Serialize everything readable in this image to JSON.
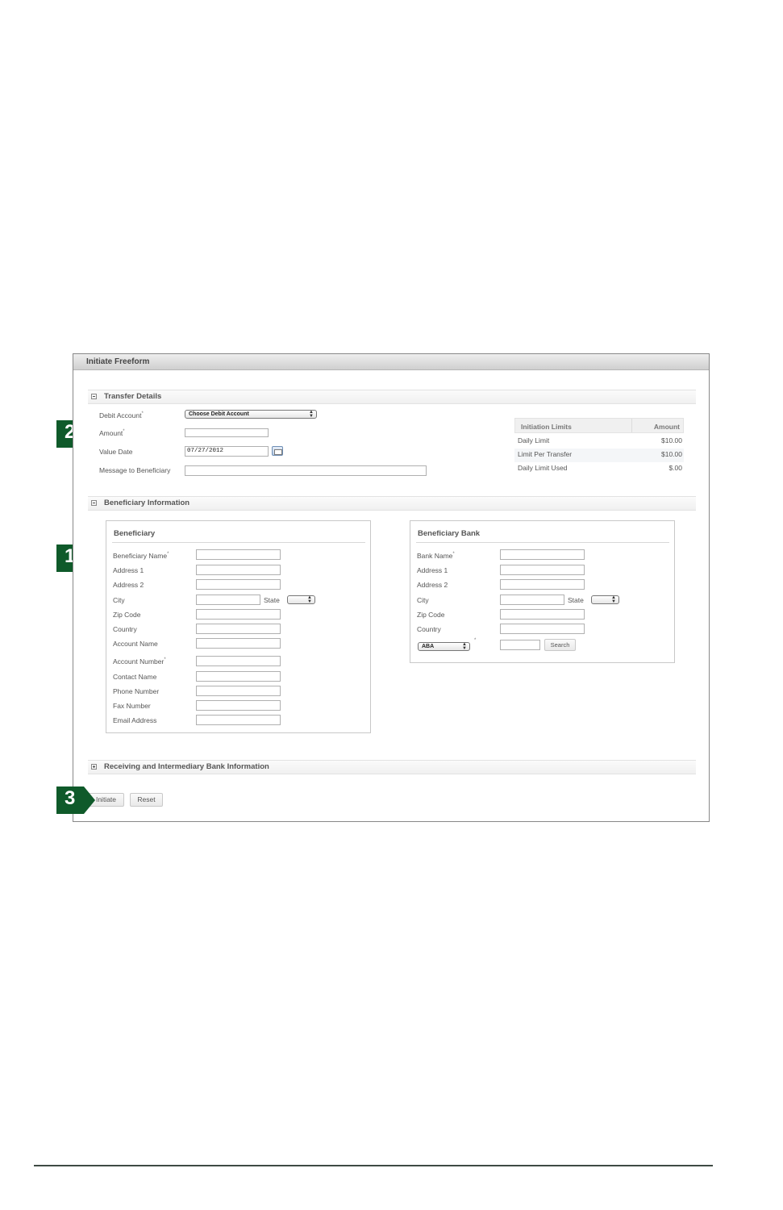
{
  "window": {
    "title": "Initiate Freeform"
  },
  "transfer_details": {
    "section_title": "Transfer Details",
    "debit_account_label": "Debit Account",
    "debit_account_value": "Choose Debit Account",
    "amount_label": "Amount",
    "value_date_label": "Value Date",
    "value_date_value": "07/27/2012",
    "message_label": "Message to Beneficiary",
    "required_marker": "*"
  },
  "initiation_limits": {
    "header_label": "Initiation Limits",
    "header_amount": "Amount",
    "rows": [
      {
        "label": "Daily Limit",
        "amount": "$10.00"
      },
      {
        "label": "Limit Per Transfer",
        "amount": "$10.00"
      },
      {
        "label": "Daily Limit Used",
        "amount": "$.00"
      }
    ]
  },
  "beneficiary_information": {
    "section_title": "Beneficiary Information",
    "beneficiary": {
      "title": "Beneficiary",
      "fields": {
        "name": "Beneficiary Name",
        "address1": "Address 1",
        "address2": "Address 2",
        "city": "City",
        "state": "State",
        "zip": "Zip Code",
        "country": "Country",
        "account_name": "Account Name",
        "account_number": "Account Number",
        "contact_name": "Contact Name",
        "phone": "Phone Number",
        "fax": "Fax Number",
        "email": "Email Address"
      }
    },
    "bank": {
      "title": "Beneficiary Bank",
      "fields": {
        "bank_name": "Bank Name",
        "address1": "Address 1",
        "address2": "Address 2",
        "city": "City",
        "state": "State",
        "zip": "Zip Code",
        "country": "Country"
      },
      "routing_type_value": "ABA",
      "search_label": "Search"
    }
  },
  "receiving_section": {
    "title": "Receiving and Intermediary Bank Information"
  },
  "actions": {
    "initiate_label": "Initiate",
    "reset_label": "Reset"
  },
  "markers": [
    {
      "number": "1"
    },
    {
      "number": "2"
    },
    {
      "number": "3"
    }
  ],
  "colors": {
    "marker_green": "#0f5a2a"
  }
}
